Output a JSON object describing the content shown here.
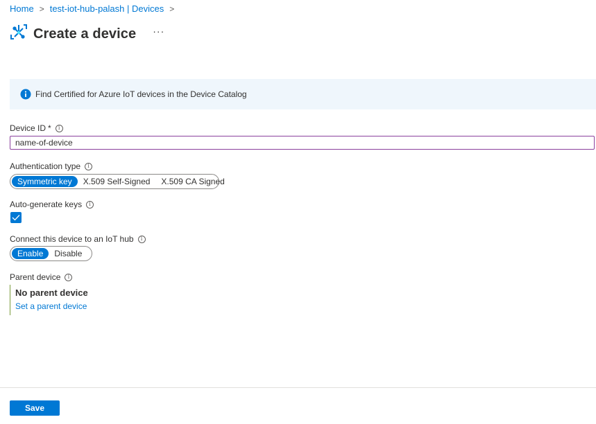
{
  "breadcrumb": {
    "home": "Home",
    "hub": "test-iot-hub-palash | Devices",
    "separator": ">"
  },
  "header": {
    "title": "Create a device",
    "more": "···",
    "icon": "iot-device-icon"
  },
  "info": {
    "text": "Find Certified for Azure IoT devices in the Device Catalog",
    "icon": "info-icon"
  },
  "device_id": {
    "label": "Device ID",
    "required_mark": "*",
    "value": "name-of-device"
  },
  "auth": {
    "label": "Authentication type",
    "options": [
      "Symmetric key",
      "X.509 Self-Signed",
      "X.509 CA Signed"
    ],
    "selected": "Symmetric key"
  },
  "auto_keys": {
    "label": "Auto-generate keys",
    "checked": true
  },
  "connect": {
    "label": "Connect this device to an IoT hub",
    "options": [
      "Enable",
      "Disable"
    ],
    "selected": "Enable"
  },
  "parent": {
    "label": "Parent device",
    "value": "No parent device",
    "link": "Set a parent device"
  },
  "footer": {
    "save": "Save"
  },
  "colors": {
    "accent": "#0078d4",
    "info_bg": "#eff6fc",
    "input_border": "#8a3f9c"
  }
}
